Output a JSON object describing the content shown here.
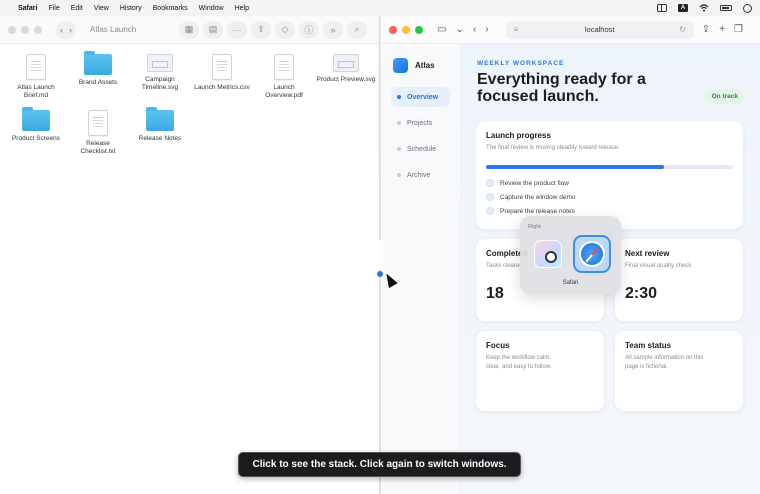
{
  "menubar": {
    "apple_icon": "apple-icon",
    "app_name": "Safari",
    "items": [
      "File",
      "Edit",
      "View",
      "History",
      "Bookmarks",
      "Window",
      "Help"
    ],
    "status_letter": "A"
  },
  "finder": {
    "title": "Atlas Launch",
    "files": [
      {
        "name": "Atlas Launch Brief.md",
        "kind": "doc"
      },
      {
        "name": "Brand Assets",
        "kind": "folder"
      },
      {
        "name": "Campaign Timeline.svg",
        "kind": "image"
      },
      {
        "name": "Launch Metrics.csv",
        "kind": "doc"
      },
      {
        "name": "Launch Overview.pdf",
        "kind": "doc"
      },
      {
        "name": "Product Preview.svg",
        "kind": "image"
      },
      {
        "name": "Product Screens",
        "kind": "folder"
      },
      {
        "name": "Release Checklist.txt",
        "kind": "doc"
      },
      {
        "name": "Release Notes",
        "kind": "folder"
      }
    ]
  },
  "safari": {
    "url": "localhost",
    "brand": "Atlas",
    "nav": [
      {
        "label": "Overview",
        "active": true
      },
      {
        "label": "Projects",
        "active": false
      },
      {
        "label": "Schedule",
        "active": false
      },
      {
        "label": "Archive",
        "active": false
      }
    ],
    "eyebrow": "WEEKLY WORKSPACE",
    "headline": "Everything ready for a focused launch.",
    "status_badge": "On track",
    "progress_card": {
      "title": "Launch progress",
      "subtitle": "The final review is moving steadily toward release.",
      "progress": 0.72,
      "checklist": [
        "Review the product flow",
        "Capture the window demo",
        "Prepare the release notes"
      ]
    },
    "completed_card": {
      "title": "Completed",
      "subtitle": "Tasks cleared",
      "value": "18"
    },
    "next_review_card": {
      "title": "Next review",
      "subtitle": "Final visual quality check",
      "value": "2:30"
    },
    "focus_card": {
      "title": "Focus",
      "subtitle": "Keep the workflow calm, clear, and easy to follow."
    },
    "team_card": {
      "title": "Team status",
      "subtitle": "All sample information on this page is fictional."
    }
  },
  "switcher": {
    "hint": "Right",
    "selected_app": "Safari"
  },
  "toast": "Click to see the stack. Click again to switch windows.",
  "colors": {
    "accent": "#2d77e6",
    "success": "#2b8a43"
  }
}
